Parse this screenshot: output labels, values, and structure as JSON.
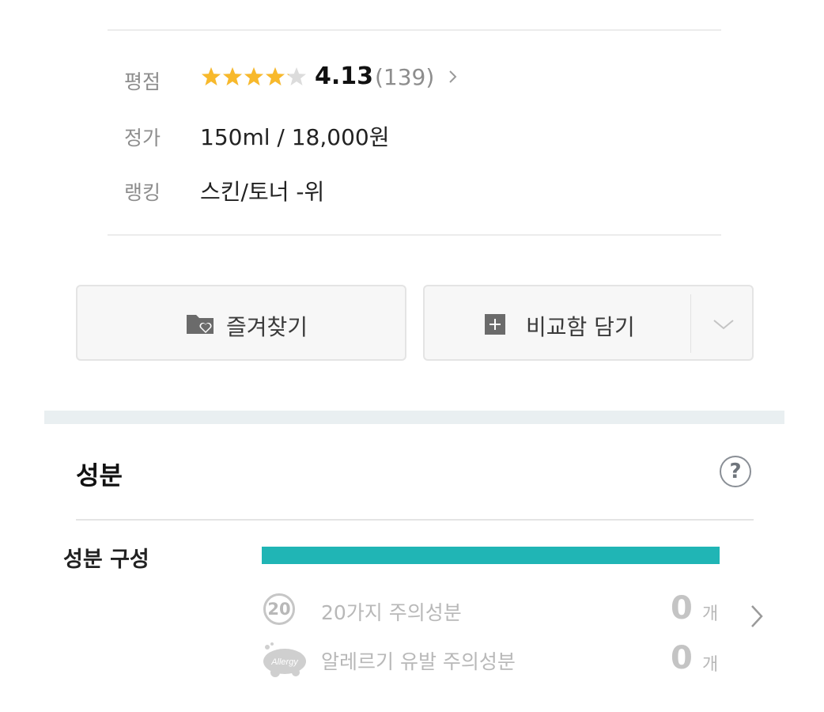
{
  "info": {
    "rating": {
      "label": "평점",
      "score": "4.13",
      "score_value": 4.13,
      "count": "(139)",
      "star_color": "#f8b92b",
      "star_empty_color": "#dcdcdc"
    },
    "price": {
      "label": "정가",
      "value": "150ml / 18,000원"
    },
    "ranking": {
      "label": "랭킹",
      "value": "스킨/토너 -위"
    }
  },
  "actions": {
    "favorite_label": "즐겨찾기",
    "favorite_icon": "folder-heart-icon",
    "compare_label": "비교함 담기",
    "compare_icon": "plus-square-icon",
    "dropdown_icon": "chevron-down-icon"
  },
  "ingredients": {
    "title": "성분",
    "help_icon": "question-circle-icon",
    "help_glyph": "?",
    "composition_label": "성분 구성",
    "composition_fraction": 1.0,
    "bar_color": "#20b5b5",
    "badge_20_text": "20",
    "warnings": [
      {
        "label": "20가지 주의성분",
        "count": "0",
        "unit": "개"
      },
      {
        "label": "알레르기 유발 주의성분",
        "count": "0",
        "unit": "개"
      }
    ],
    "allergy_badge_text": "Allergy"
  }
}
